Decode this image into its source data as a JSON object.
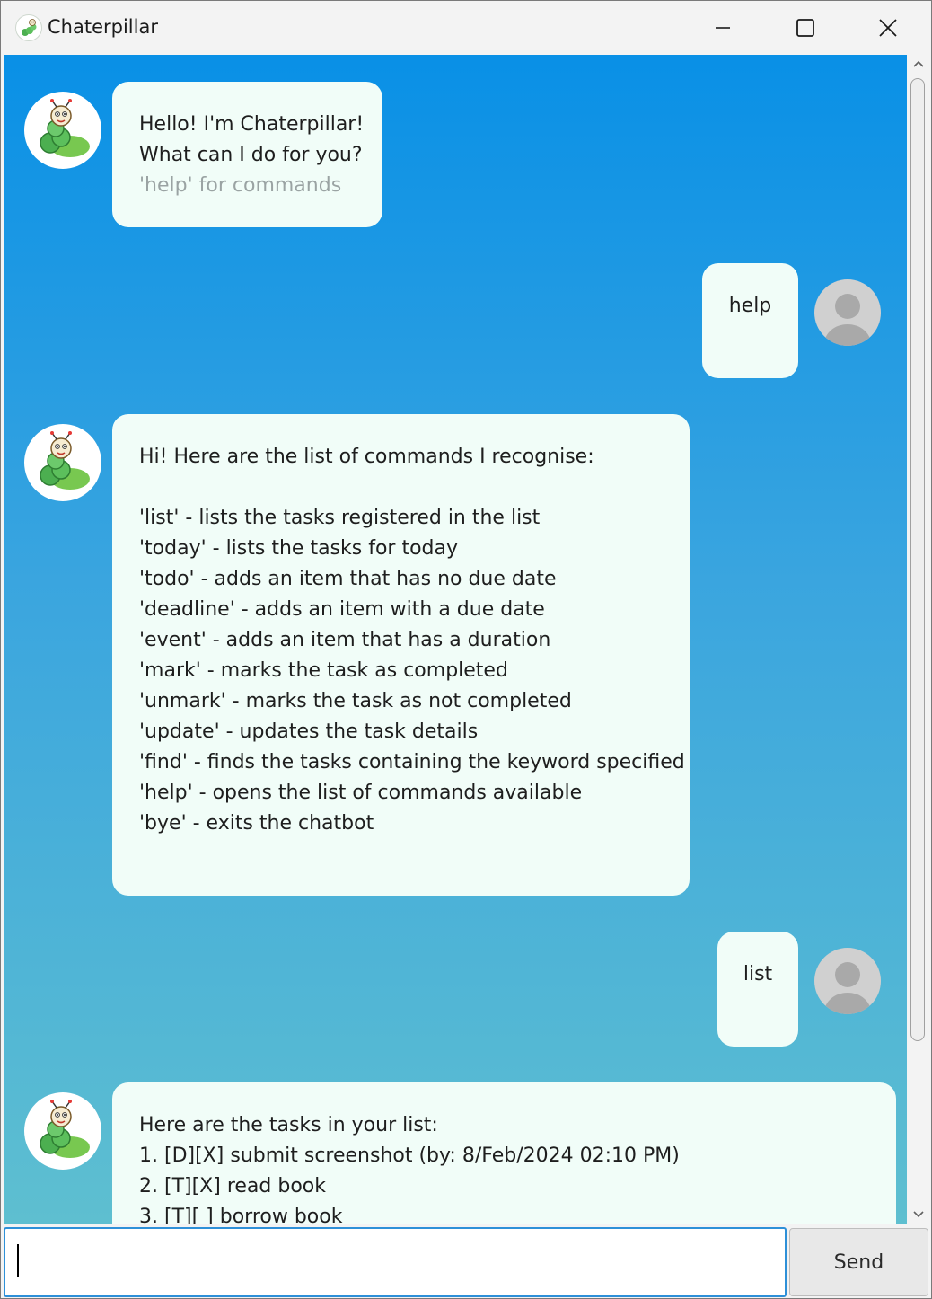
{
  "window": {
    "title": "Chaterpillar"
  },
  "messages": [
    {
      "sender": "bot",
      "lines": [
        "Hello! I'm Chaterpillar!",
        "What can I do for you?"
      ],
      "hint": "'help' for commands"
    },
    {
      "sender": "user",
      "lines": [
        "help"
      ]
    },
    {
      "sender": "bot",
      "lines": [
        "Hi! Here are the list of commands I recognise:",
        "",
        "'list' - lists the tasks registered in the list",
        "'today' - lists the tasks for today",
        "'todo' - adds an item that has no due date",
        "'deadline' - adds an item with a due date",
        "'event' - adds an item that has a duration",
        "'mark' - marks the task as completed",
        "'unmark' - marks the task as not completed",
        "'update' - updates the task details",
        "'find' - finds the tasks containing the keyword specified",
        "'help' - opens the list of commands available",
        "'bye' - exits the chatbot"
      ]
    },
    {
      "sender": "user",
      "lines": [
        "list"
      ]
    },
    {
      "sender": "bot",
      "lines": [
        "Here are the tasks in your list:",
        "1. [D][X] submit screenshot (by: 8/Feb/2024 02:10 PM)",
        "2. [T][X] read book",
        "3. [T][ ] borrow book"
      ]
    }
  ],
  "input": {
    "value": "",
    "send_label": "Send"
  },
  "icons": {
    "app": "caterpillar-icon",
    "bot_avatar": "caterpillar-avatar",
    "user_avatar": "user-silhouette-icon",
    "minimize": "minimize-icon",
    "maximize": "maximize-icon",
    "close": "close-icon"
  },
  "colors": {
    "gradient_top": "#0990e6",
    "gradient_bottom": "#5ebfd0",
    "bubble": "#f1fdf8",
    "hint_text": "#9aa3a3",
    "input_border": "#2e90d8"
  }
}
